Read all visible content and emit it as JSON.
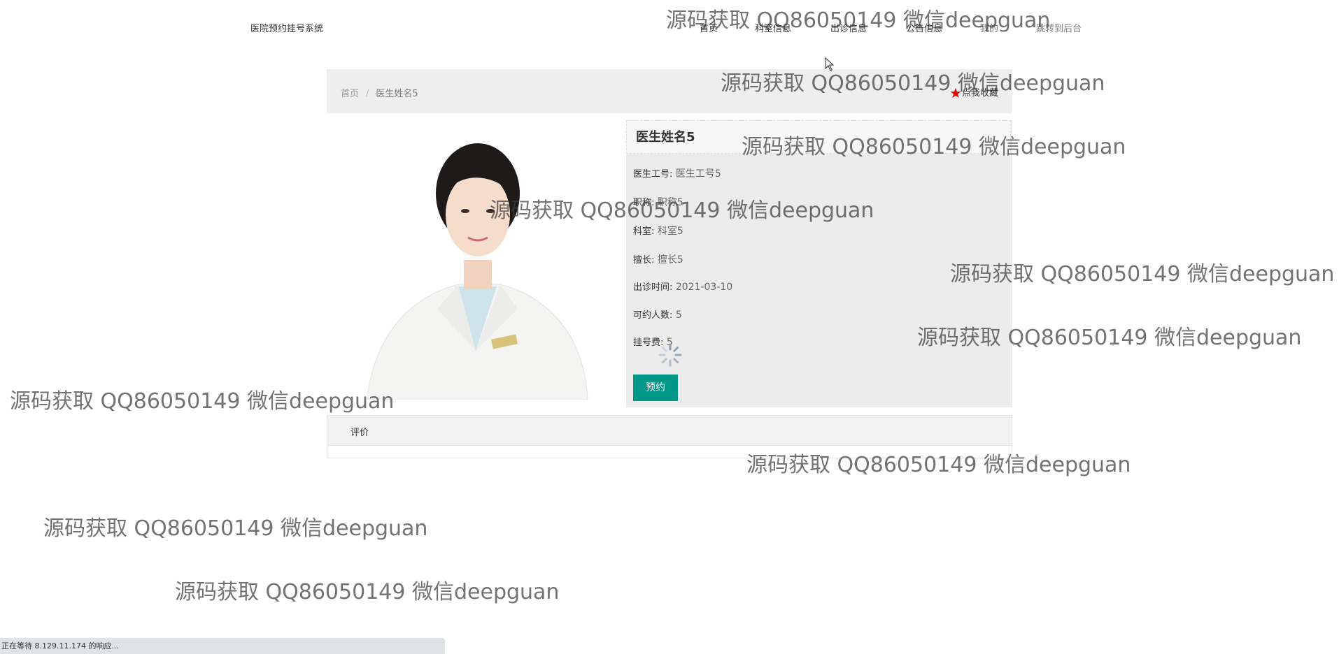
{
  "header": {
    "site_title": "医院预约挂号系统",
    "nav": [
      {
        "label": "首页"
      },
      {
        "label": "科室信息"
      },
      {
        "label": "出诊信息"
      },
      {
        "label": "公告信息"
      },
      {
        "label": "我的"
      },
      {
        "label": "跳转到后台"
      }
    ]
  },
  "breadcrumb": {
    "home": "首页",
    "separator": "/",
    "current": "医生姓名5",
    "favorite_label": "点我收藏"
  },
  "doctor": {
    "name": "医生姓名5",
    "fields": [
      {
        "key": "医生工号:",
        "value": "医生工号5"
      },
      {
        "key": "职称:",
        "value": "职称5"
      },
      {
        "key": "科室:",
        "value": "科室5"
      },
      {
        "key": "擅长:",
        "value": "擅长5"
      },
      {
        "key": "出诊时间:",
        "value": "2021-03-10"
      },
      {
        "key": "可约人数:",
        "value": "5"
      },
      {
        "key": "挂号费:",
        "value": "5"
      }
    ],
    "book_button": "预约"
  },
  "tabs": {
    "review": "评价"
  },
  "watermark_text": "源码获取 QQ86050149 微信deepguan",
  "status_bar": "正在等待 8.129.11.174 的响应...",
  "colors": {
    "accent": "#009688",
    "star": "#e60000",
    "panel_bg": "#ececec"
  }
}
